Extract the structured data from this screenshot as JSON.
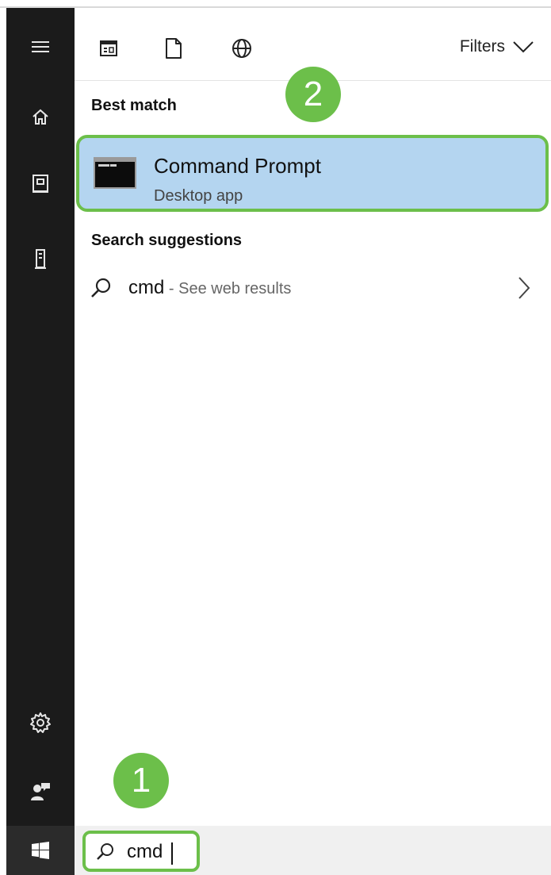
{
  "filters": {
    "label": "Filters"
  },
  "best_match": {
    "heading": "Best match",
    "title": "Command Prompt",
    "subtitle": "Desktop app"
  },
  "suggestions": {
    "heading": "Search suggestions",
    "items": [
      {
        "query": "cmd",
        "hint": " - See web results"
      }
    ]
  },
  "search": {
    "value": "cmd"
  },
  "callouts": {
    "one": "1",
    "two": "2"
  },
  "colors": {
    "highlight": "#b4d5f0",
    "callout_green": "#6cbf4a",
    "rail": "#1b1b1b"
  }
}
